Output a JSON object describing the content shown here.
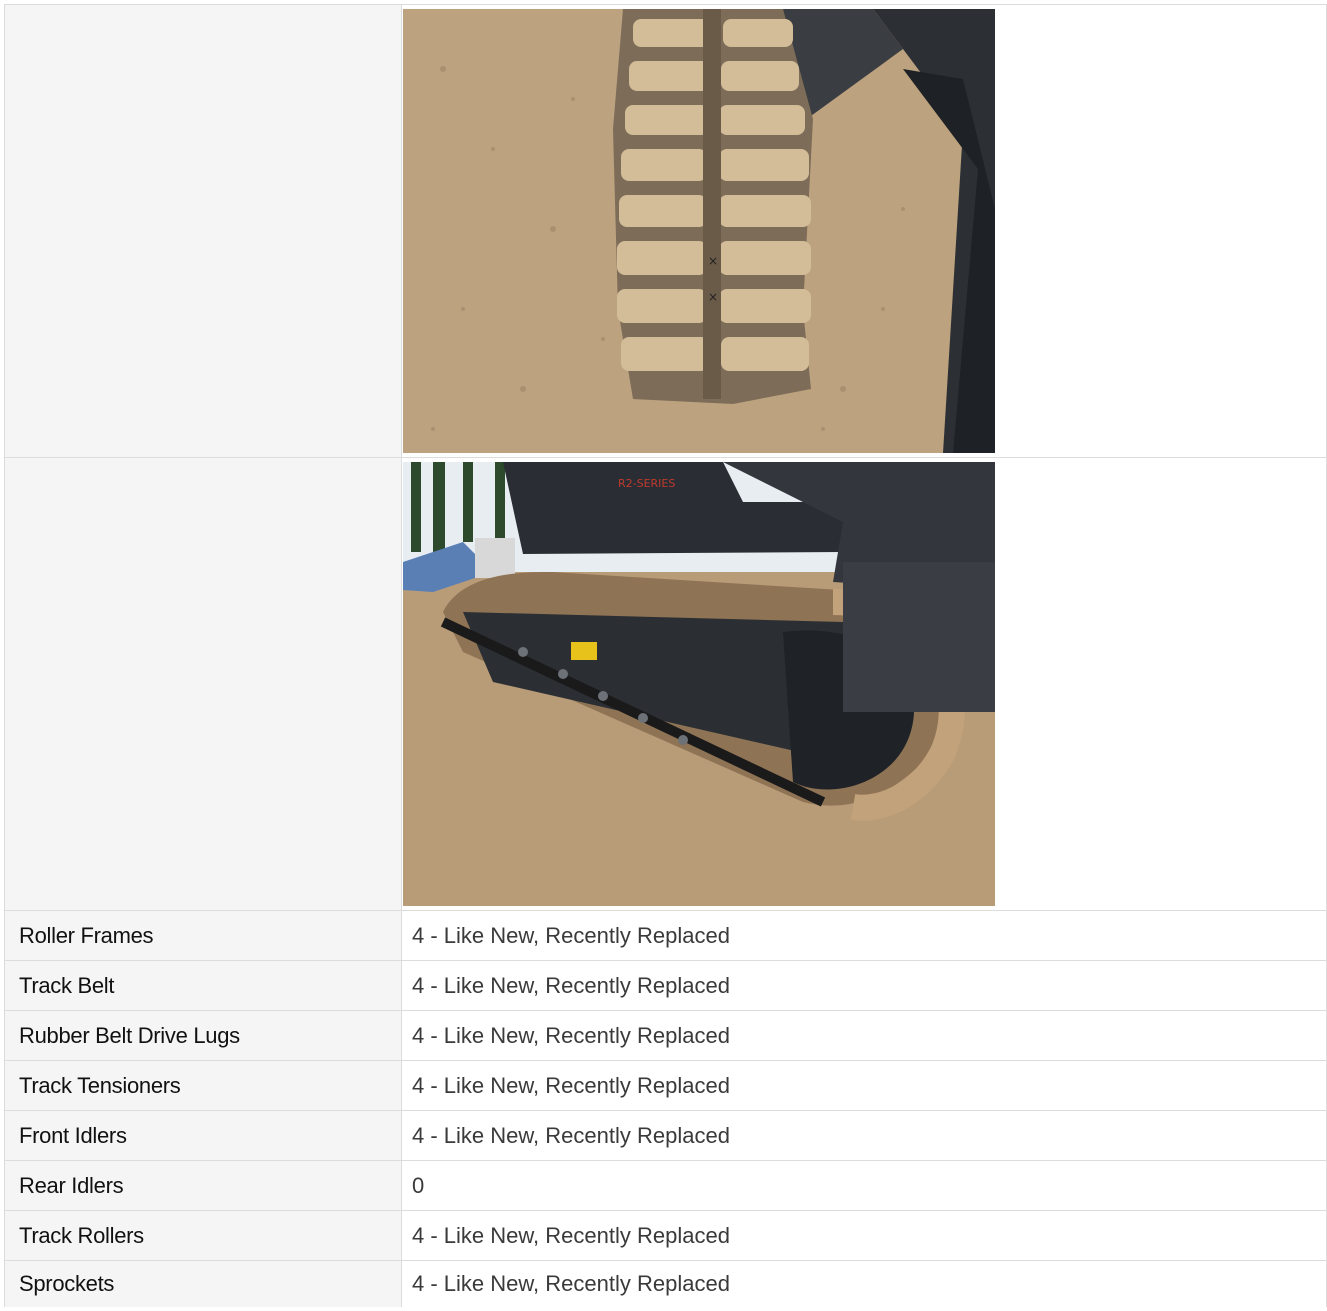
{
  "photos": [
    {
      "alt": "",
      "subject": "track-top-view"
    },
    {
      "alt": "",
      "subject": "undercarriage-side-view"
    }
  ],
  "rows": [
    {
      "label": "Roller Frames",
      "value": "4 - Like New, Recently Replaced"
    },
    {
      "label": "Track Belt",
      "value": "4 - Like New, Recently Replaced"
    },
    {
      "label": "Rubber Belt Drive Lugs",
      "value": "4 - Like New, Recently Replaced"
    },
    {
      "label": "Track Tensioners",
      "value": "4 - Like New, Recently Replaced"
    },
    {
      "label": "Front Idlers",
      "value": "4 - Like New, Recently Replaced"
    },
    {
      "label": "Rear Idlers",
      "value": "0"
    },
    {
      "label": "Track Rollers",
      "value": "4 - Like New, Recently Replaced"
    },
    {
      "label": "Sprockets",
      "value": "4 - Like New, Recently Replaced"
    }
  ],
  "colors": {
    "label_bg": "#f5f5f5",
    "border": "#dcdcdc",
    "label_text": "#111111",
    "value_text": "#3a3a3a"
  }
}
